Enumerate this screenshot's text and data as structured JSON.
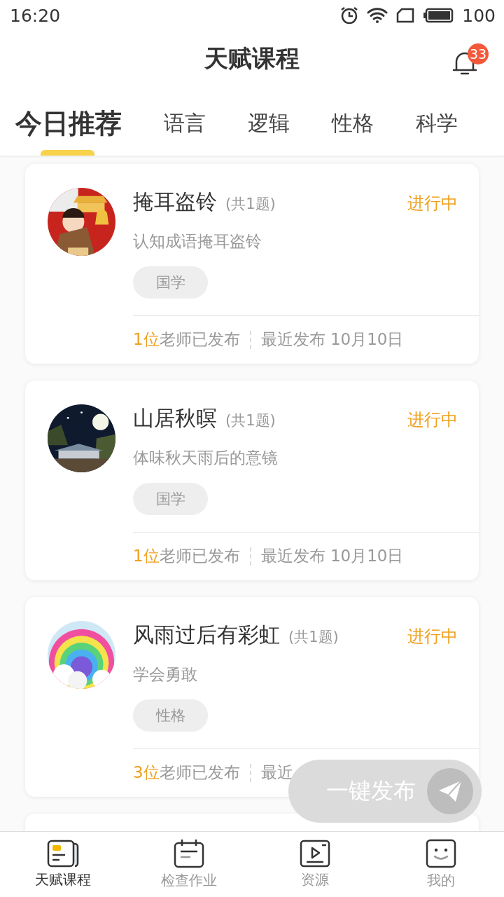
{
  "status_bar": {
    "time": "16:20",
    "battery": "100"
  },
  "header": {
    "title": "天赋课程",
    "notification_count": "33"
  },
  "tabs": [
    {
      "label": "今日推荐",
      "selected": true
    },
    {
      "label": "语言",
      "selected": false
    },
    {
      "label": "逻辑",
      "selected": false
    },
    {
      "label": "性格",
      "selected": false
    },
    {
      "label": "科学",
      "selected": false
    }
  ],
  "courses": [
    {
      "kind": "full",
      "title": "掩耳盗铃",
      "count": "(共1题)",
      "status": "进行中",
      "description": "认知成语掩耳盗铃",
      "tag": "国学",
      "teacher_count": "1位",
      "teacher_text": "老师已发布",
      "recent": "最近发布 10月10日"
    },
    {
      "kind": "full",
      "title": "山居秋暝",
      "count": "(共1题)",
      "status": "进行中",
      "description": "体味秋天雨后的意镜",
      "tag": "国学",
      "teacher_count": "1位",
      "teacher_text": "老师已发布",
      "recent": "最近发布 10月10日"
    },
    {
      "kind": "full",
      "title": "风雨过后有彩虹",
      "count": "(共1题)",
      "status": "进行中",
      "description": "学会勇敢",
      "tag": "性格",
      "teacher_count": "3位",
      "teacher_text": "老师已发布",
      "recent": "最近"
    },
    {
      "kind": "empty"
    }
  ],
  "publish_button": {
    "label": "一键发布"
  },
  "bottom_nav": [
    {
      "label": "天赋课程",
      "selected": true
    },
    {
      "label": "检查作业",
      "selected": false
    },
    {
      "label": "资源",
      "selected": false
    },
    {
      "label": "我的",
      "selected": false
    }
  ]
}
